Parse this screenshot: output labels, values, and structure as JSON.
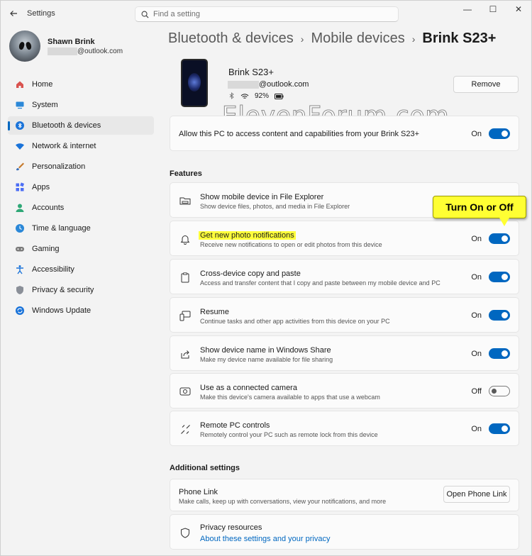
{
  "window": {
    "app_title": "Settings",
    "controls": {
      "minimize": "—",
      "maximize": "☐",
      "close": "✕"
    }
  },
  "search": {
    "placeholder": "Find a setting"
  },
  "profile": {
    "name": "Shawn Brink",
    "email_domain": "@outlook.com"
  },
  "nav": [
    {
      "label": "Home",
      "icon": "home-icon",
      "color": "#d9534f"
    },
    {
      "label": "System",
      "icon": "monitor-icon",
      "color": "#2b88d8"
    },
    {
      "label": "Bluetooth & devices",
      "icon": "bluetooth-icon",
      "color": "#1a73d9",
      "active": true
    },
    {
      "label": "Network & internet",
      "icon": "wifi-icon",
      "color": "#1a73d9"
    },
    {
      "label": "Personalization",
      "icon": "brush-icon",
      "color": "#c67a2c"
    },
    {
      "label": "Apps",
      "icon": "apps-icon",
      "color": "#4c6ef5"
    },
    {
      "label": "Accounts",
      "icon": "person-icon",
      "color": "#2fa877"
    },
    {
      "label": "Time & language",
      "icon": "globe-clock-icon",
      "color": "#2b88d8"
    },
    {
      "label": "Gaming",
      "icon": "gamepad-icon",
      "color": "#6b6b6b"
    },
    {
      "label": "Accessibility",
      "icon": "accessibility-icon",
      "color": "#1a73d9"
    },
    {
      "label": "Privacy & security",
      "icon": "shield-icon",
      "color": "#6b7280"
    },
    {
      "label": "Windows Update",
      "icon": "update-icon",
      "color": "#1a73d9"
    }
  ],
  "breadcrumb": {
    "level1": "Bluetooth & devices",
    "level2": "Mobile devices",
    "current": "Brink S23+",
    "separator": "›"
  },
  "device": {
    "name": "Brink S23+",
    "email_domain": "@outlook.com",
    "battery": "92%",
    "remove_label": "Remove"
  },
  "watermark": "ElevenForum.com",
  "access_card": {
    "title": "Allow this PC to access content and capabilities from your Brink S23+",
    "state_label": "On",
    "on": true
  },
  "features": {
    "heading": "Features",
    "explorer": {
      "title": "Show mobile device in File Explorer",
      "subtitle": "Show device files, photos, and media in File Explorer"
    },
    "items": [
      {
        "title": "Get new photo notifications",
        "subtitle": "Receive new notifications to open or edit photos from this device",
        "state_label": "On",
        "on": true
      },
      {
        "title": "Cross-device copy and paste",
        "subtitle": "Access and transfer content that I copy and paste between my mobile device and PC",
        "state_label": "On",
        "on": true
      },
      {
        "title": "Resume",
        "subtitle": "Continue tasks and other app activities from this device on your PC",
        "state_label": "On",
        "on": true
      },
      {
        "title": "Show device name in Windows Share",
        "subtitle": "Make my device name available for file sharing",
        "state_label": "On",
        "on": true
      },
      {
        "title": "Use as a connected camera",
        "subtitle": "Make this device's camera available to apps that use a webcam",
        "state_label": "Off",
        "on": false
      },
      {
        "title": "Remote PC controls",
        "subtitle": "Remotely control your PC such as remote lock from this device",
        "state_label": "On",
        "on": true
      }
    ]
  },
  "callout": "Turn On or Off",
  "additional": {
    "heading": "Additional settings",
    "phone_link": {
      "title": "Phone Link",
      "subtitle": "Make calls, keep up with conversations, view your notifications, and more",
      "button": "Open Phone Link"
    },
    "privacy": {
      "title": "Privacy resources",
      "link": "About these settings and your privacy"
    }
  }
}
